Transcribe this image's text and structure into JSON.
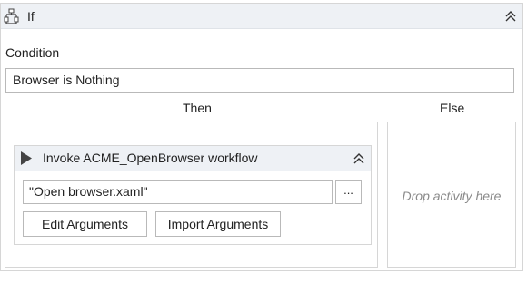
{
  "if_activity": {
    "title": "If",
    "icon": "if-branch-icon",
    "collapse_icon": "double-chevron-up-icon",
    "condition_label": "Condition",
    "condition_value": "Browser is Nothing",
    "then_label": "Then",
    "else_label": "Else",
    "else_drop_hint": "Drop activity here"
  },
  "invoke_activity": {
    "title": "Invoke ACME_OpenBrowser workflow",
    "icon": "play-icon",
    "collapse_icon": "double-chevron-up-icon",
    "file_value": "\"Open browser.xaml\"",
    "browse_label": "...",
    "edit_arguments_label": "Edit Arguments",
    "import_arguments_label": "Import Arguments"
  }
}
